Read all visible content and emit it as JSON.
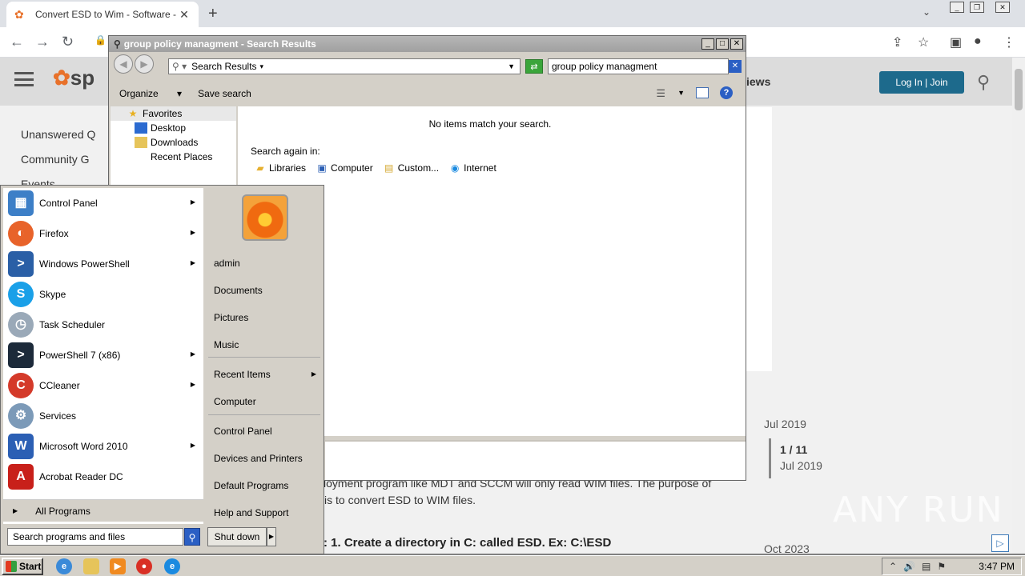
{
  "browser": {
    "tab_title": "Convert ESD to Wim - Software - Sp",
    "tab_close": "✕",
    "new_tab": "+"
  },
  "website": {
    "logo_text": "sp",
    "header_link": "iews",
    "login_button": "Log In | Join",
    "nav_items": [
      "Unanswered Q",
      "Community G",
      "Events"
    ],
    "date_top": "Jul 2019",
    "page_counter": "1 / 11",
    "page_counter_date": "Jul 2019",
    "date_bottom": "Oct 2023",
    "body_line1": "loyment program like MDT and SCCM will only read WIM files. The purpose of",
    "body_line2": "is to convert ESD to WIM files.",
    "step_heading": ": 1. Create a directory in C: called ESD. Ex: C:\\ESD",
    "watermark": "ANY RUN"
  },
  "explorer": {
    "title": "group policy managment - Search Results",
    "address": "Search Results",
    "search_value": "group policy managment",
    "cmd_organize": "Organize",
    "cmd_save_search": "Save search",
    "nav_favorites": "Favorites",
    "nav_items": [
      "Desktop",
      "Downloads",
      "Recent Places"
    ],
    "no_items": "No items match your search.",
    "search_again": "Search again in:",
    "search_again_items": [
      "Libraries",
      "Computer",
      "Custom...",
      "Internet"
    ]
  },
  "startmenu": {
    "programs": [
      {
        "label": "Control Panel",
        "icon": "control-panel-icon",
        "color": "#3d7fc7",
        "arrow": true
      },
      {
        "label": "Firefox",
        "icon": "firefox-icon",
        "color": "#e8632a",
        "arrow": true
      },
      {
        "label": "Windows PowerShell",
        "icon": "powershell-icon",
        "color": "#2a5fa6",
        "arrow": true
      },
      {
        "label": "Skype",
        "icon": "skype-icon",
        "color": "#1aa0e8",
        "arrow": false
      },
      {
        "label": "Task Scheduler",
        "icon": "clock-icon",
        "color": "#9aa9b8",
        "arrow": false
      },
      {
        "label": "PowerShell 7 (x86)",
        "icon": "powershell7-icon",
        "color": "#1c2a3a",
        "arrow": true
      },
      {
        "label": "CCleaner",
        "icon": "ccleaner-icon",
        "color": "#d43a2a",
        "arrow": true
      },
      {
        "label": "Services",
        "icon": "gears-icon",
        "color": "#7c9ab8",
        "arrow": false
      },
      {
        "label": "Microsoft Word 2010",
        "icon": "word-icon",
        "color": "#2b5fb4",
        "arrow": true
      },
      {
        "label": "Acrobat Reader DC",
        "icon": "acrobat-icon",
        "color": "#c8201a",
        "arrow": false
      }
    ],
    "all_programs": "All Programs",
    "search_placeholder": "Search programs and files",
    "user": "admin",
    "right_items": [
      "Documents",
      "Pictures",
      "Music"
    ],
    "recent_items": "Recent Items",
    "computer": "Computer",
    "right_items2": [
      "Control Panel",
      "Devices and Printers",
      "Default Programs",
      "Help and Support"
    ],
    "shut_down": "Shut down"
  },
  "taskbar": {
    "start": "Start",
    "clock": "3:47 PM"
  }
}
